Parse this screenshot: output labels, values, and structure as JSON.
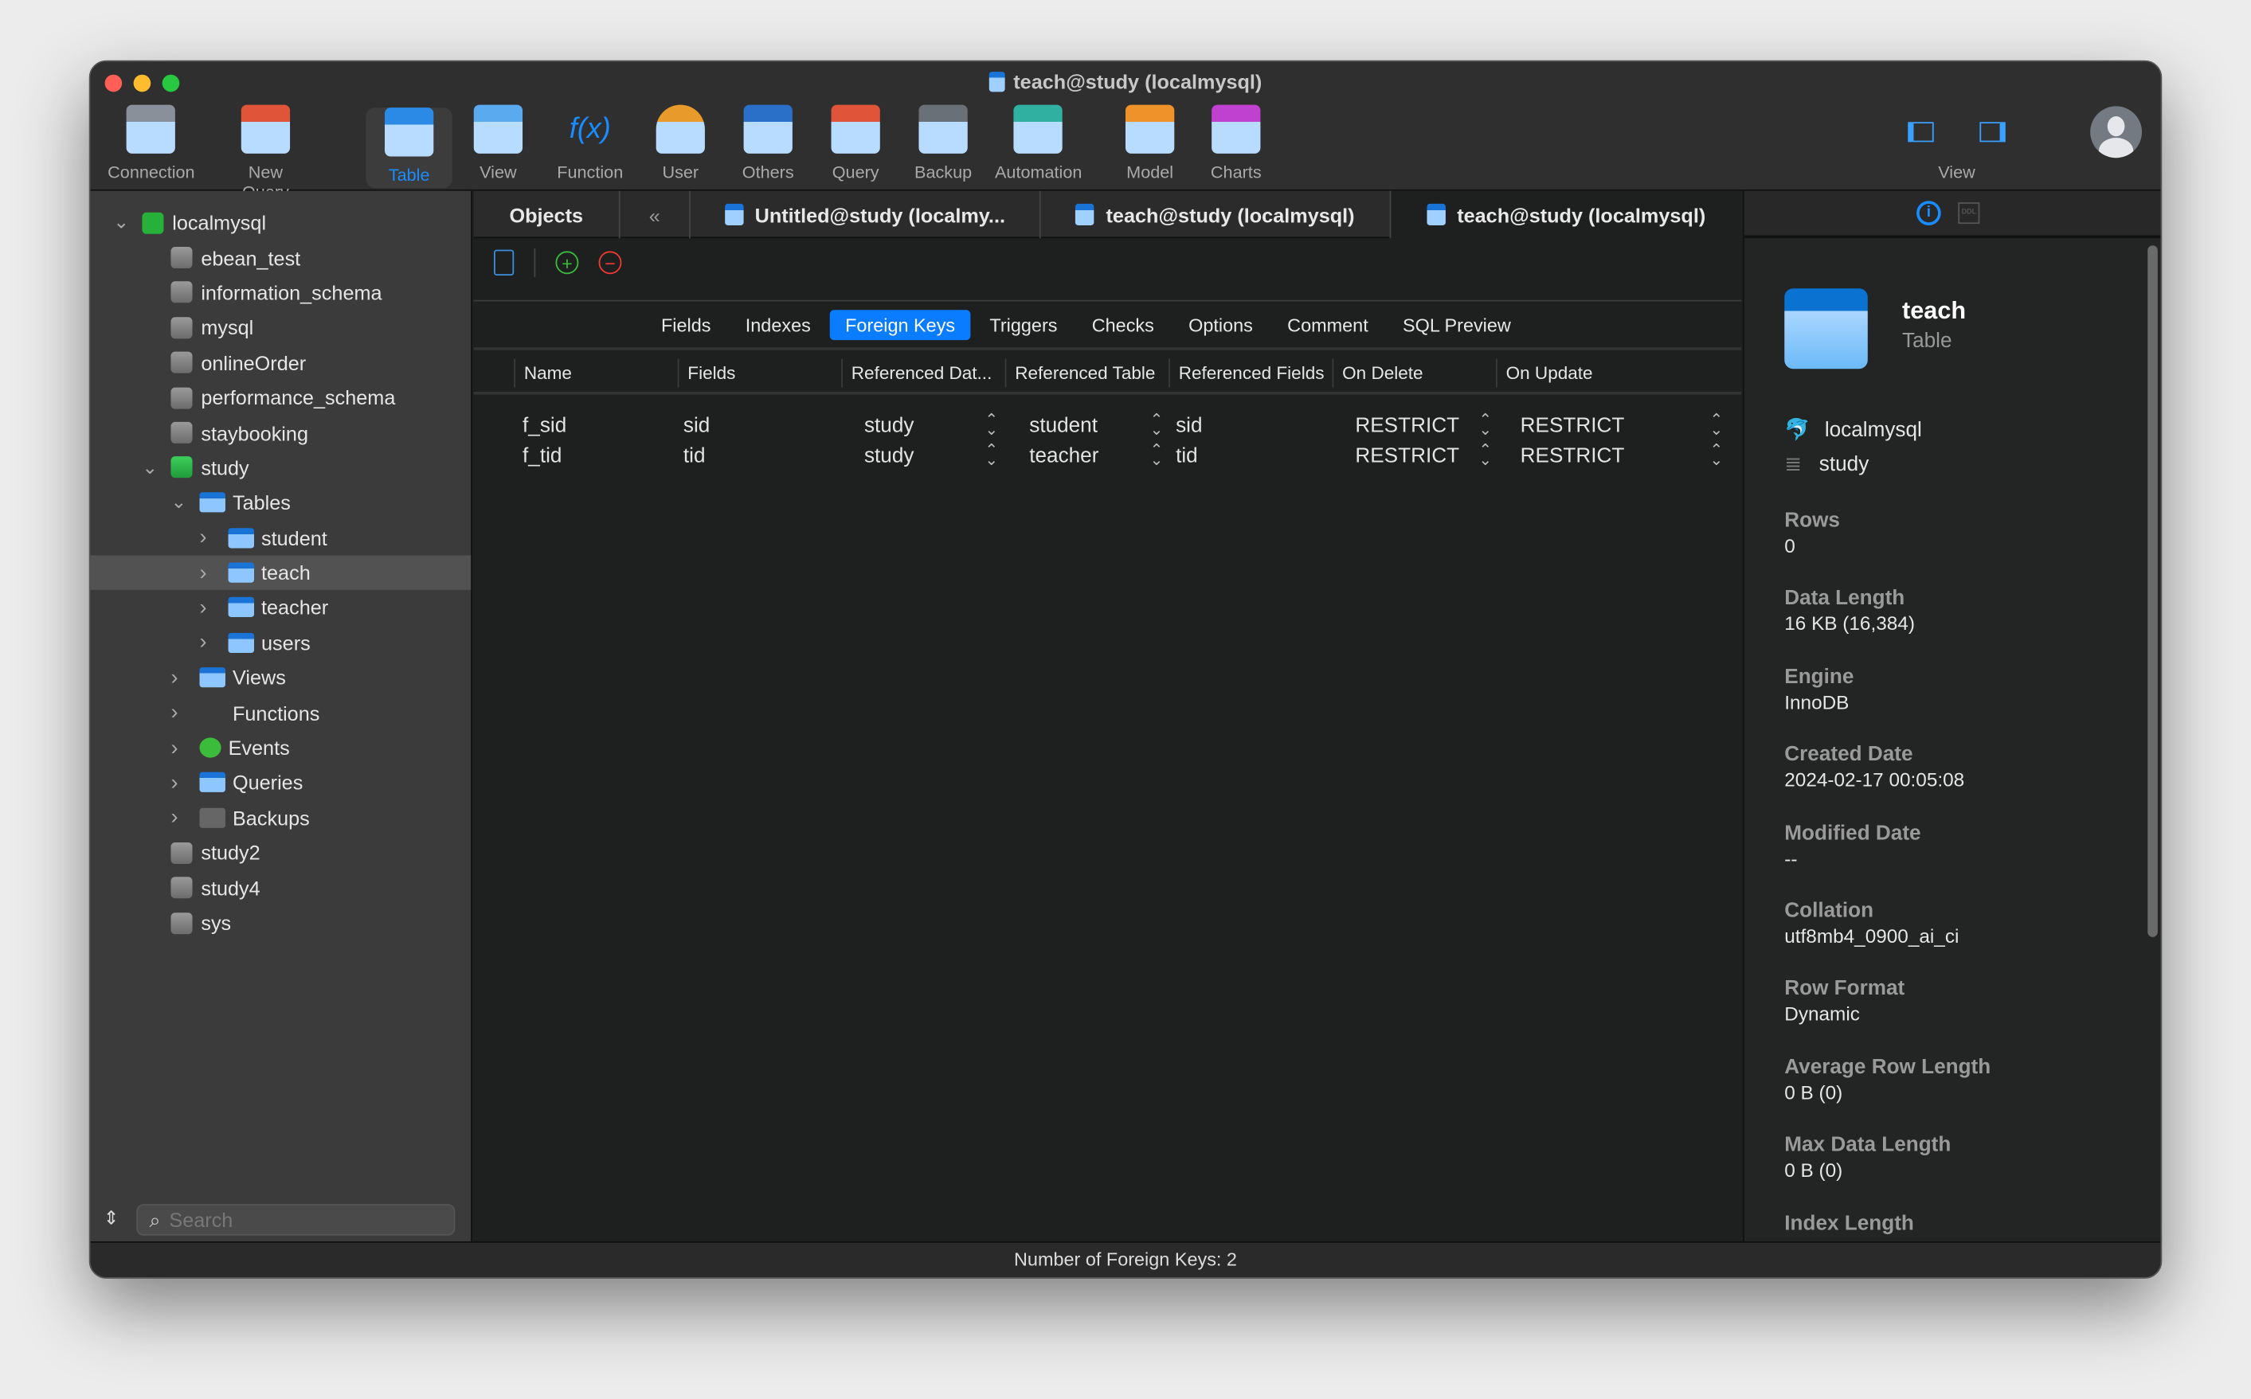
{
  "window": {
    "title": "teach@study (localmysql)"
  },
  "toolbar": {
    "items": [
      {
        "label": "Connection",
        "icon": "connection-icon"
      },
      {
        "label": "New Query",
        "icon": "new-query-icon"
      },
      {
        "label": "Table",
        "icon": "table-icon"
      },
      {
        "label": "View",
        "icon": "view-icon"
      },
      {
        "label": "Function",
        "icon": "function-icon"
      },
      {
        "label": "User",
        "icon": "user-icon"
      },
      {
        "label": "Others",
        "icon": "others-icon"
      },
      {
        "label": "Query",
        "icon": "query-icon"
      },
      {
        "label": "Backup",
        "icon": "backup-icon"
      },
      {
        "label": "Automation",
        "icon": "automation-icon"
      },
      {
        "label": "Model",
        "icon": "model-icon"
      },
      {
        "label": "Charts",
        "icon": "charts-icon"
      }
    ],
    "view_label": "View",
    "function_glyph": "f(x)"
  },
  "sidebar": {
    "items": [
      "localmysql",
      "ebean_test",
      "information_schema",
      "mysql",
      "onlineOrder",
      "performance_schema",
      "staybooking",
      "study",
      "Tables",
      "student",
      "teach",
      "teacher",
      "users",
      "Views",
      "Functions",
      "Events",
      "Queries",
      "Backups",
      "study2",
      "study4",
      "sys"
    ],
    "search_placeholder": "Search"
  },
  "tabs": [
    "Objects",
    "Untitled@study (localmy...",
    "teach@study (localmysql)",
    "teach@study (localmysql)"
  ],
  "subtabs": [
    "Fields",
    "Indexes",
    "Foreign Keys",
    "Triggers",
    "Checks",
    "Options",
    "Comment",
    "SQL Preview"
  ],
  "table": {
    "headers": [
      "Name",
      "Fields",
      "Referenced Dat...",
      "Referenced Table",
      "Referenced Fields",
      "On Delete",
      "On Update"
    ],
    "rows": [
      [
        "f_sid",
        "sid",
        "study",
        "student",
        "sid",
        "RESTRICT",
        "RESTRICT"
      ],
      [
        "f_tid",
        "tid",
        "study",
        "teacher",
        "tid",
        "RESTRICT",
        "RESTRICT"
      ]
    ]
  },
  "info": {
    "name": "teach",
    "type": "Table",
    "connection": "localmysql",
    "database": "study",
    "ddl_label": "DDL",
    "props": [
      {
        "k": "Rows",
        "v": "0"
      },
      {
        "k": "Data Length",
        "v": "16 KB (16,384)"
      },
      {
        "k": "Engine",
        "v": "InnoDB"
      },
      {
        "k": "Created Date",
        "v": "2024-02-17 00:05:08"
      },
      {
        "k": "Modified Date",
        "v": "--"
      },
      {
        "k": "Collation",
        "v": "utf8mb4_0900_ai_ci"
      },
      {
        "k": "Row Format",
        "v": "Dynamic"
      },
      {
        "k": "Average Row Length",
        "v": "0 B (0)"
      },
      {
        "k": "Max Data Length",
        "v": "0 B (0)"
      },
      {
        "k": "Index Length",
        "v": ""
      }
    ]
  },
  "status": "Number of Foreign Keys: 2",
  "colors": {
    "accent": "#0a7cff"
  }
}
